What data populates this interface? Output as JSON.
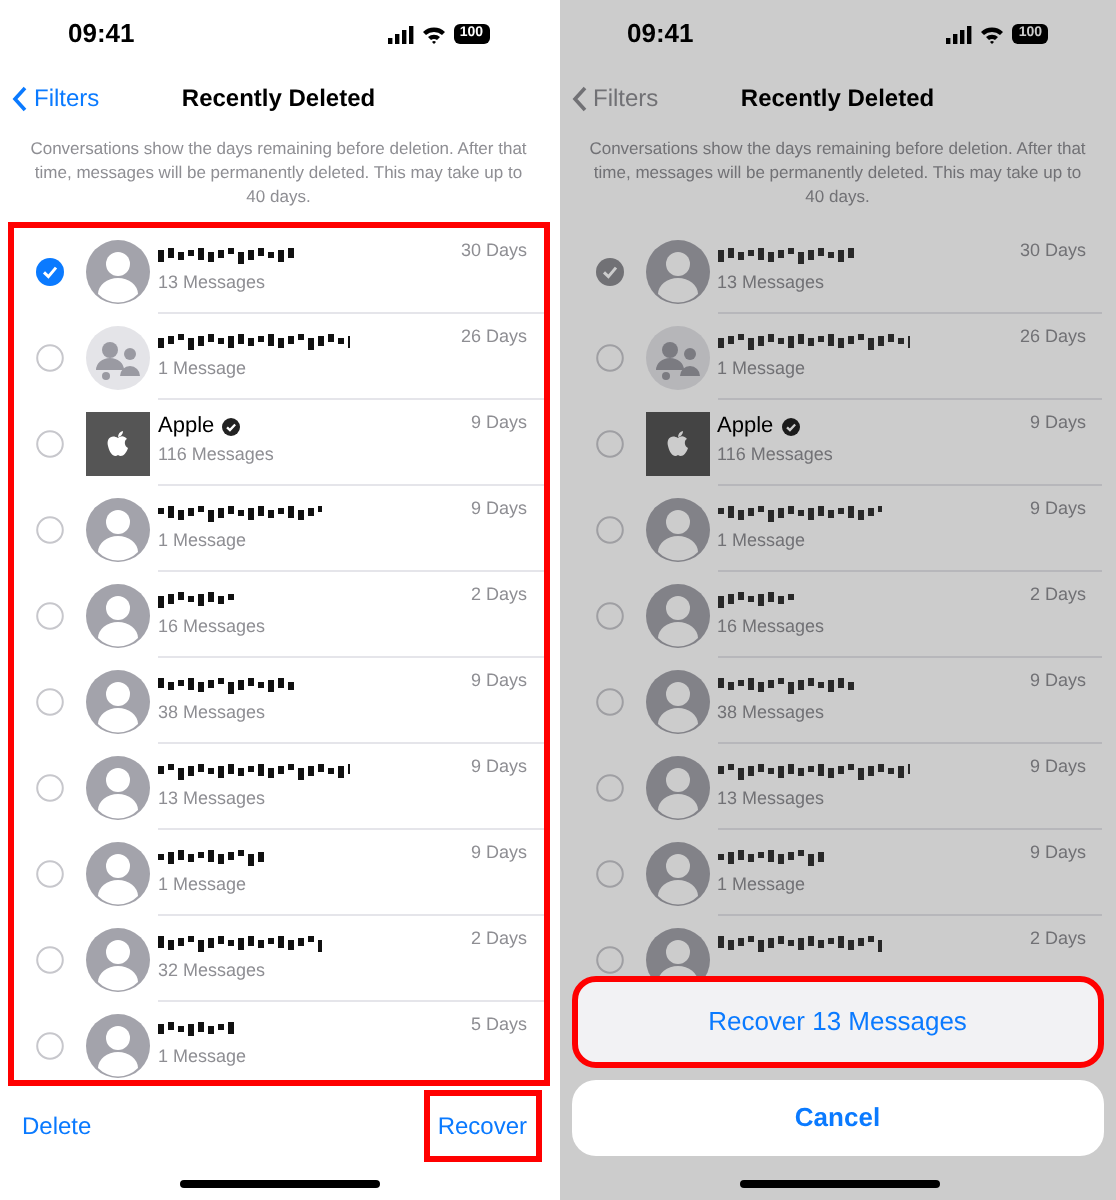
{
  "panels": [
    {
      "dimmed": false,
      "status_bar": {
        "time": "09:41",
        "battery": "100"
      },
      "nav": {
        "back": "Filters",
        "title": "Recently Deleted"
      },
      "notice": "Conversations show the days remaining before deletion. After that time, messages will be permanently deleted. This may take up to 40 days.",
      "list_highlighted": true,
      "rows": [
        {
          "kind": "person",
          "days": "30 Days",
          "count": "13 Messages",
          "selected": true
        },
        {
          "kind": "group",
          "days": "26 Days",
          "count": "1 Message",
          "selected": false
        },
        {
          "kind": "apple",
          "name": "Apple",
          "days": "9 Days",
          "count": "116 Messages",
          "selected": false
        },
        {
          "kind": "person",
          "days": "9 Days",
          "count": "1 Message",
          "selected": false
        },
        {
          "kind": "person",
          "days": "2 Days",
          "count": "16 Messages",
          "selected": false
        },
        {
          "kind": "person",
          "days": "9 Days",
          "count": "38 Messages",
          "selected": false
        },
        {
          "kind": "person",
          "days": "9 Days",
          "count": "13 Messages",
          "selected": false
        },
        {
          "kind": "person",
          "days": "9 Days",
          "count": "1 Message",
          "selected": false
        },
        {
          "kind": "person",
          "days": "2 Days",
          "count": "32 Messages",
          "selected": false
        },
        {
          "kind": "person",
          "days": "5 Days",
          "count": "1 Message",
          "selected": false
        }
      ],
      "toolbar": {
        "delete": "Delete",
        "recover": "Recover",
        "recover_highlighted": true
      }
    },
    {
      "dimmed": true,
      "status_bar": {
        "time": "09:41",
        "battery": "100"
      },
      "nav": {
        "back": "Filters",
        "title": "Recently Deleted"
      },
      "notice": "Conversations show the days remaining before deletion. After that time, messages will be permanently deleted. This may take up to 40 days.",
      "list_highlighted": false,
      "rows": [
        {
          "kind": "person",
          "days": "30 Days",
          "count": "13 Messages",
          "selected": true
        },
        {
          "kind": "group",
          "days": "26 Days",
          "count": "1 Message",
          "selected": false
        },
        {
          "kind": "apple",
          "name": "Apple",
          "days": "9 Days",
          "count": "116 Messages",
          "selected": false
        },
        {
          "kind": "person",
          "days": "9 Days",
          "count": "1 Message",
          "selected": false
        },
        {
          "kind": "person",
          "days": "2 Days",
          "count": "16 Messages",
          "selected": false
        },
        {
          "kind": "person",
          "days": "9 Days",
          "count": "38 Messages",
          "selected": false
        },
        {
          "kind": "person",
          "days": "9 Days",
          "count": "13 Messages",
          "selected": false
        },
        {
          "kind": "person",
          "days": "9 Days",
          "count": "1 Message",
          "selected": false
        },
        {
          "kind": "person",
          "days": "2 Days",
          "selected": false
        }
      ],
      "action_sheet": {
        "action": "Recover 13 Messages",
        "action_highlighted": true,
        "cancel": "Cancel"
      }
    }
  ]
}
